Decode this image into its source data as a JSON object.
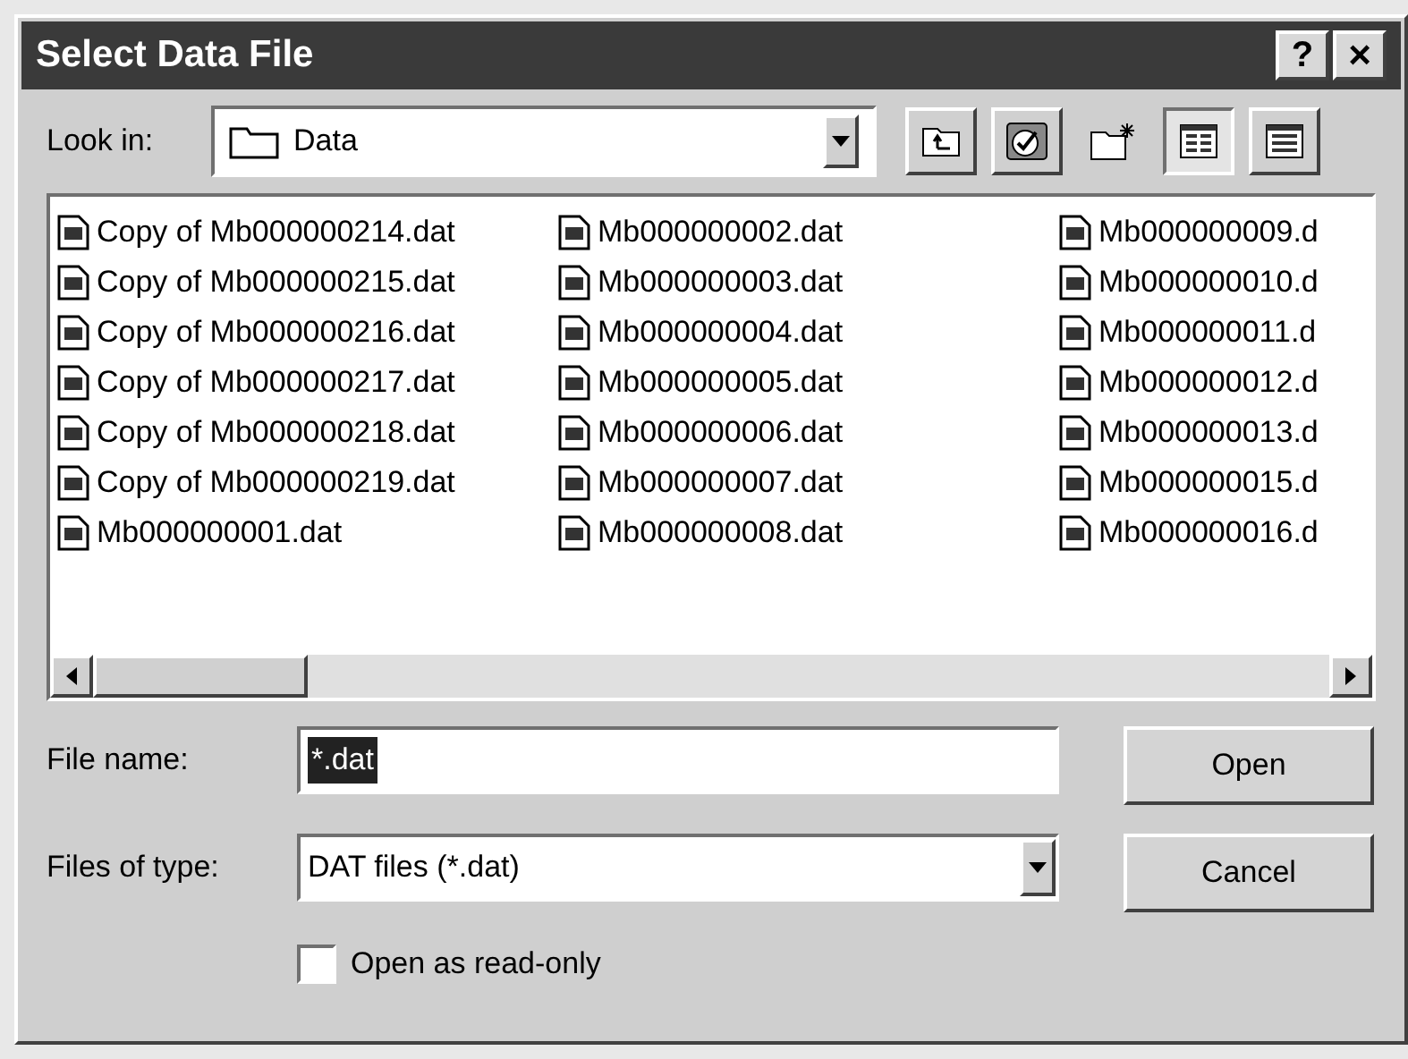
{
  "window": {
    "title": "Select Data File",
    "help": "?",
    "close": "×"
  },
  "look_in": {
    "label": "Look in:",
    "value": "Data"
  },
  "views": [
    {
      "kind": "list",
      "selected": true
    },
    {
      "kind": "details",
      "selected": false
    }
  ],
  "files": [
    "Copy of Mb000000214.dat",
    "Copy of Mb000000215.dat",
    "Copy of Mb000000216.dat",
    "Copy of Mb000000217.dat",
    "Copy of Mb000000218.dat",
    "Copy of Mb000000219.dat",
    "Mb000000001.dat",
    "Mb000000002.dat",
    "Mb000000003.dat",
    "Mb000000004.dat",
    "Mb000000005.dat",
    "Mb000000006.dat",
    "Mb000000007.dat",
    "Mb000000008.dat",
    "Mb000000009.d",
    "Mb000000010.d",
    "Mb000000011.d",
    "Mb000000012.d",
    "Mb000000013.d",
    "Mb000000015.d",
    "Mb000000016.d"
  ],
  "file_name": {
    "label": "File name:",
    "value": "*.dat"
  },
  "file_type": {
    "label": "Files of type:",
    "value": "DAT files (*.dat)"
  },
  "read_only": {
    "label": "Open as read-only",
    "checked": false
  },
  "buttons": [
    "Open",
    "Cancel"
  ]
}
